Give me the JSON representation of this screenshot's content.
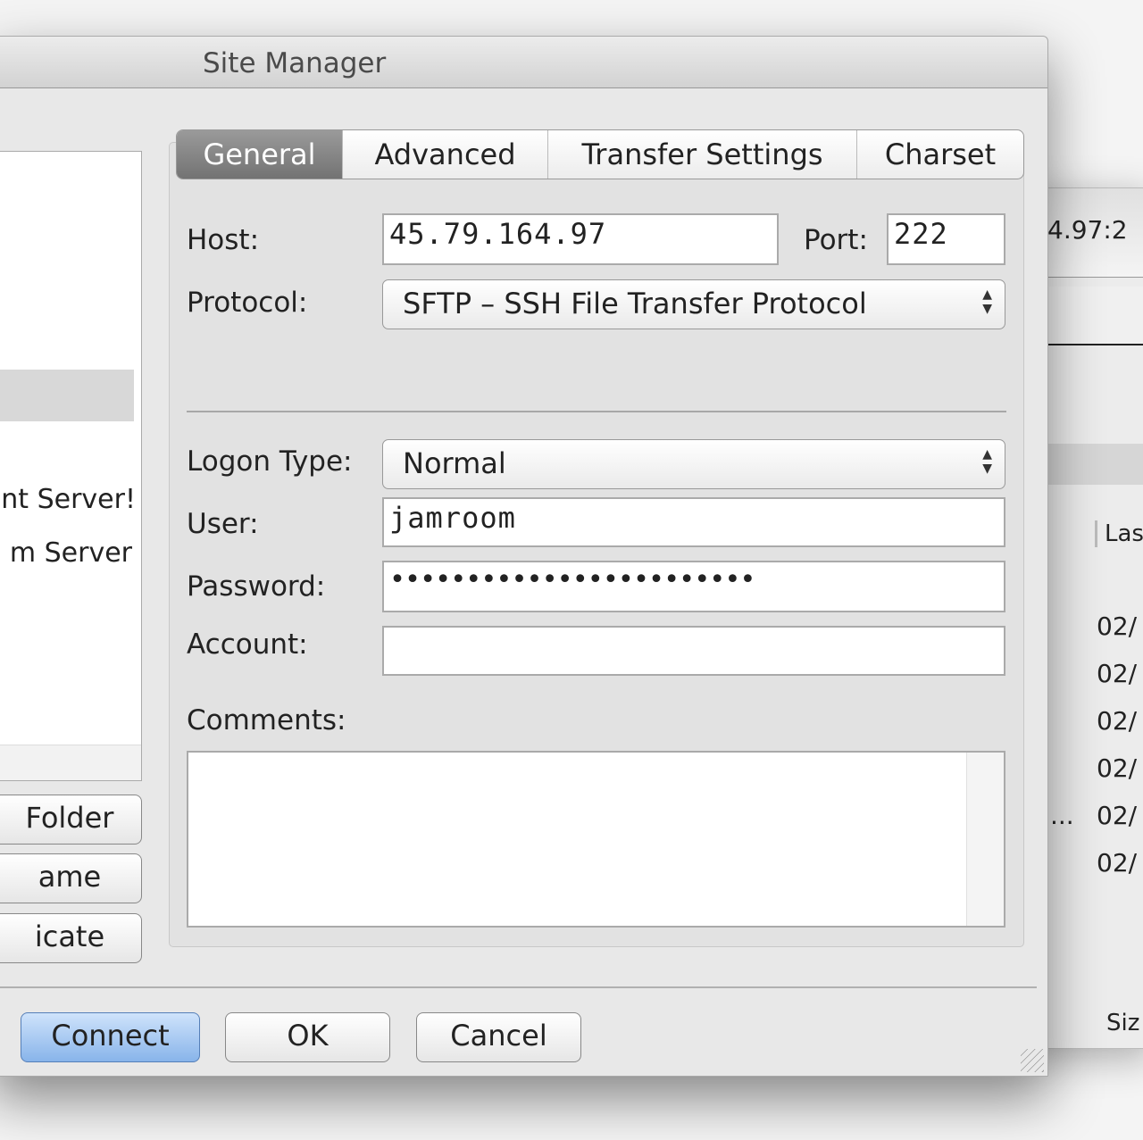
{
  "window": {
    "title": "Site Manager"
  },
  "background_window": {
    "address_fragment": "4.97:2",
    "col_last": "Las",
    "col_size": "Siz",
    "dates": [
      "02/",
      "02/",
      "02/",
      "02/",
      "02/",
      "02/"
    ],
    "ellipsis": "..."
  },
  "site_list": {
    "items": [
      "nt Server!",
      "m Server"
    ]
  },
  "side_buttons": {
    "new_folder": "Folder",
    "rename": "ame",
    "duplicate": "icate"
  },
  "tabs": [
    "General",
    "Advanced",
    "Transfer Settings",
    "Charset"
  ],
  "form": {
    "host_label": "Host:",
    "host": "45.79.164.97",
    "port_label": "Port:",
    "port": "222",
    "protocol_label": "Protocol:",
    "protocol": "SFTP – SSH File Transfer Protocol",
    "logon_label": "Logon Type:",
    "logon": "Normal",
    "user_label": "User:",
    "user": "jamroom",
    "password_label": "Password:",
    "password": "••••••••••••••••••••••••",
    "account_label": "Account:",
    "account": "",
    "comments_label": "Comments:",
    "comments": ""
  },
  "buttons": {
    "connect": "Connect",
    "ok": "OK",
    "cancel": "Cancel"
  }
}
